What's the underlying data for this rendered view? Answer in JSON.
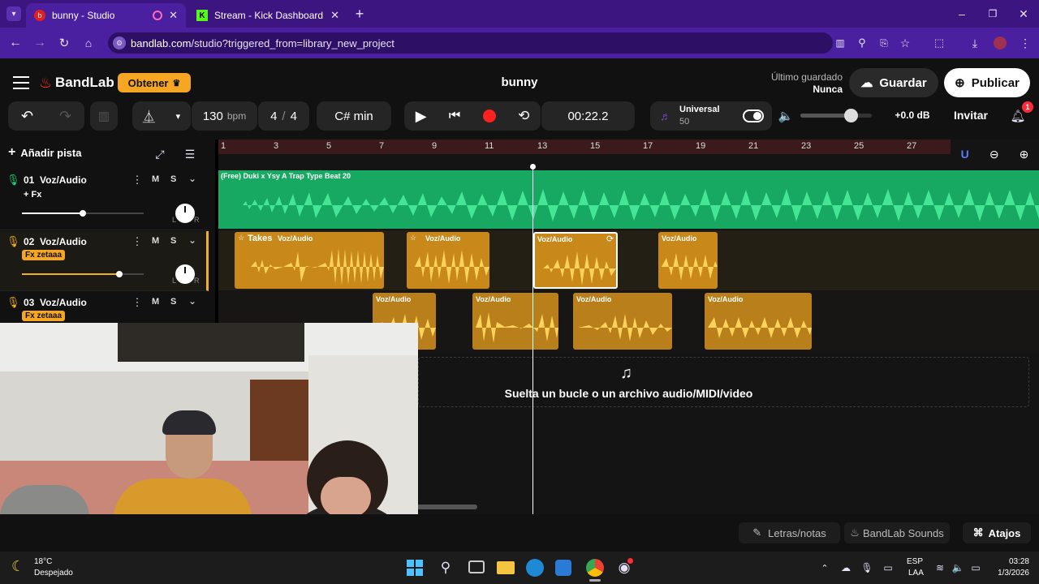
{
  "browser": {
    "tabs": [
      {
        "title": "bunny - Studio"
      },
      {
        "title": "Stream - Kick Dashboard"
      }
    ],
    "url_domain": "bandlab.com",
    "url_path": "/studio?triggered_from=library_new_project"
  },
  "header": {
    "brand": "BandLab",
    "get_button": "Obtener",
    "project_title": "bunny",
    "last_saved_label": "Último guardado",
    "last_saved_value": "Nunca",
    "save_button": "Guardar",
    "publish_button": "Publicar"
  },
  "transport": {
    "bpm_value": "130",
    "bpm_unit": "bpm",
    "time_sig_num": "4",
    "time_sig_sep": "/",
    "time_sig_den": "4",
    "key": "C# min",
    "time": "00:22.2",
    "instrument_name": "Universal",
    "instrument_value": "50",
    "volume_db": "+0.0 dB",
    "invite_button": "Invitar",
    "notification_count": "1",
    "volume_level": 0.7
  },
  "tracks_panel": {
    "add_track": "Añadir pista",
    "tracks": [
      {
        "number": "01",
        "name": "Voz/Audio",
        "fx": "+ Fx",
        "mute": "M",
        "solo": "S",
        "volume": 0.5
      },
      {
        "number": "02",
        "name": "Voz/Audio",
        "fx": "Fx zetaaa",
        "mute": "M",
        "solo": "S",
        "volume": 0.8
      },
      {
        "number": "03",
        "name": "Voz/Audio",
        "fx": "Fx zetaaa",
        "mute": "M",
        "solo": "S"
      }
    ],
    "pan_left": "L",
    "pan_right": "R"
  },
  "ruler": {
    "bars": [
      "1",
      "3",
      "5",
      "7",
      "9",
      "11",
      "13",
      "15",
      "17",
      "19",
      "21",
      "23",
      "25",
      "27"
    ]
  },
  "clips": {
    "track1": "(Free) Duki  x Ysy A  Trap Type Beat  20",
    "takes_label": "Takes",
    "clip_label": "Voz/Audio"
  },
  "dropzone": {
    "text": "Suelta un bucle o un archivo audio/MIDI/video"
  },
  "bottom": {
    "lyrics": "Letras/notas",
    "sounds": "BandLab Sounds",
    "shortcuts": "Atajos"
  },
  "taskbar": {
    "temperature": "18°C",
    "weather": "Despejado",
    "lang": "ESP",
    "lang_sub": "LAA",
    "time": "03:28",
    "date": "1/3/2026"
  },
  "colors": {
    "chrome": "#4a1fa0",
    "accent_orange": "#f5a623",
    "track1_green": "#1bd17a",
    "track_yellow": "#f2b01e",
    "record_red": "#ff2020"
  }
}
